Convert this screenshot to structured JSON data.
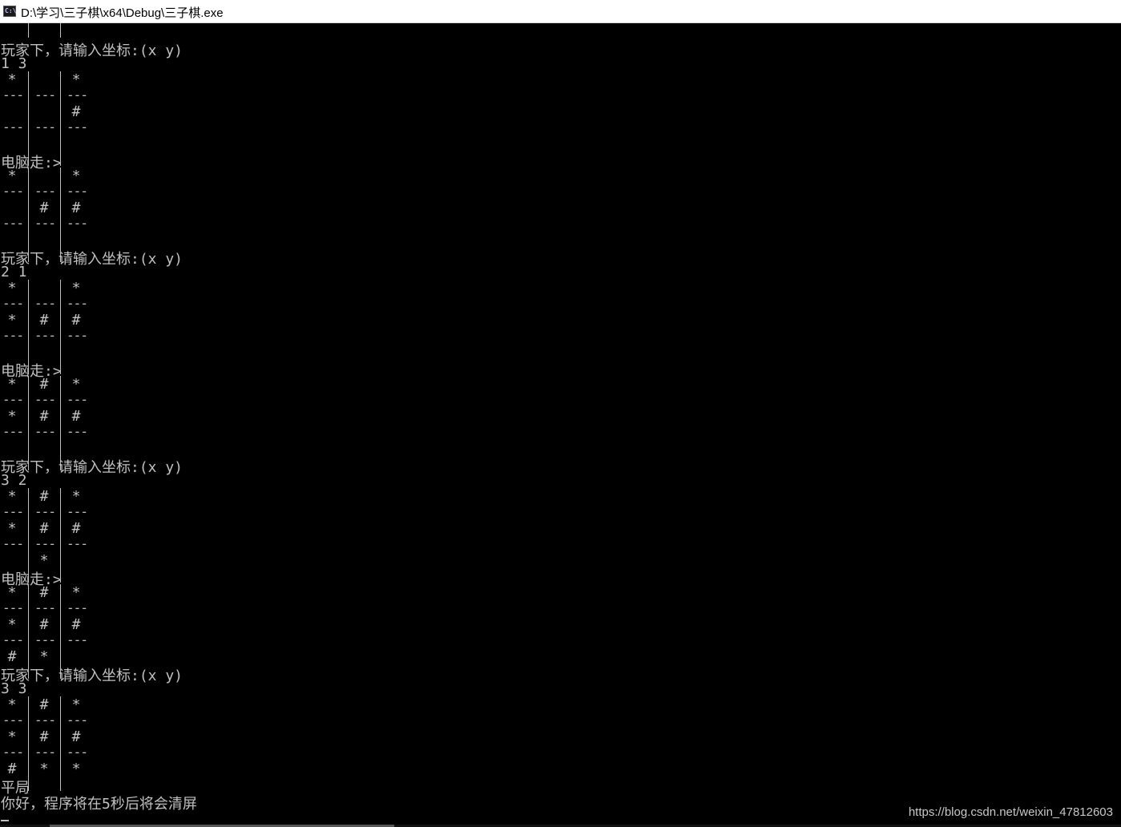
{
  "window": {
    "title": "D:\\学习\\三子棋\\x64\\Debug\\三子棋.exe",
    "icon": "console-app-icon",
    "icon_text": "C:\\"
  },
  "console": {
    "entries": [
      {
        "type": "text",
        "text": "玩家下，请输入坐标:(x y)"
      },
      {
        "type": "text",
        "text": "1 3"
      },
      {
        "type": "board",
        "rows": [
          [
            "*",
            " ",
            "*"
          ],
          [
            " ",
            " ",
            "#"
          ],
          [
            " ",
            " ",
            " "
          ]
        ]
      },
      {
        "type": "text",
        "text": "电脑走:>"
      },
      {
        "type": "board",
        "rows": [
          [
            "*",
            " ",
            "*"
          ],
          [
            " ",
            "#",
            "#"
          ],
          [
            " ",
            " ",
            " "
          ]
        ]
      },
      {
        "type": "text",
        "text": "玩家下，请输入坐标:(x y)"
      },
      {
        "type": "text",
        "text": "2 1"
      },
      {
        "type": "board",
        "rows": [
          [
            "*",
            " ",
            "*"
          ],
          [
            "*",
            "#",
            "#"
          ],
          [
            " ",
            " ",
            " "
          ]
        ]
      },
      {
        "type": "text",
        "text": "电脑走:>"
      },
      {
        "type": "board",
        "rows": [
          [
            "*",
            "#",
            "*"
          ],
          [
            "*",
            "#",
            "#"
          ],
          [
            " ",
            " ",
            " "
          ]
        ]
      },
      {
        "type": "text",
        "text": "玩家下，请输入坐标:(x y)"
      },
      {
        "type": "text",
        "text": "3 2"
      },
      {
        "type": "board",
        "rows": [
          [
            "*",
            "#",
            "*"
          ],
          [
            "*",
            "#",
            "#"
          ],
          [
            " ",
            "*",
            " "
          ]
        ]
      },
      {
        "type": "text",
        "text": "电脑走:>"
      },
      {
        "type": "board",
        "rows": [
          [
            "*",
            "#",
            "*"
          ],
          [
            "*",
            "#",
            "#"
          ],
          [
            "#",
            "*",
            " "
          ]
        ]
      },
      {
        "type": "text",
        "text": "玩家下，请输入坐标:(x y)"
      },
      {
        "type": "text",
        "text": "3 3"
      },
      {
        "type": "board",
        "rows": [
          [
            "*",
            "#",
            "*"
          ],
          [
            "*",
            "#",
            "#"
          ],
          [
            "#",
            "*",
            "*"
          ]
        ]
      },
      {
        "type": "text",
        "text": "平局"
      },
      {
        "type": "text",
        "text": "你好，程序将在5秒后将会清屏"
      }
    ]
  },
  "watermark": "https://blog.csdn.net/weixin_47812603",
  "colors": {
    "console_bg": "#000000",
    "console_fg": "#c0c0c0",
    "titlebar_bg": "#ffffff"
  }
}
